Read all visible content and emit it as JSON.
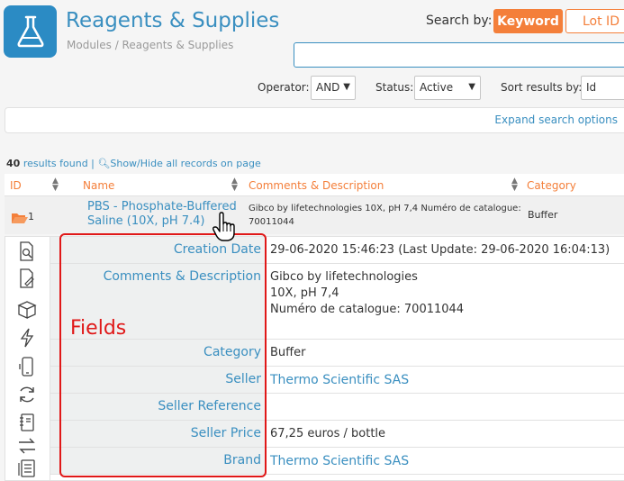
{
  "header": {
    "title": "Reagents & Supplies",
    "breadcrumb": "Modules / Reagents & Supplies",
    "app_icon": "flask-icon"
  },
  "search": {
    "label": "Search by:",
    "keyword_button": "Keyword",
    "lot_button": "Lot ID",
    "input_value": "",
    "operator_label": "Operator:",
    "operator_value": "AND",
    "status_label": "Status:",
    "status_value": "Active",
    "sort_label": "Sort results by:",
    "sort_value": "Id",
    "expand_link": "Expand search options"
  },
  "results": {
    "count": "40",
    "found_text": "results found |",
    "toggle_text": "Show/Hide all records on page"
  },
  "table": {
    "columns": [
      "ID",
      "Name",
      "Comments & Description",
      "Category"
    ],
    "row": {
      "id": "1",
      "name": "PBS - Phosphate-Buffered Saline (10X, pH 7.4)",
      "comments": "Gibco by lifetechnologies 10X, pH 7,4 Numéro de catalogue:  70011044",
      "category": "Buffer"
    }
  },
  "details": {
    "creation_date_label": "Creation Date",
    "creation_date_value": "29-06-2020 15:46:23 (Last Update: 29-06-2020 16:04:13)",
    "comments_label": "Comments & Description",
    "comments_line1": "Gibco by lifetechnologies",
    "comments_line2": "10X, pH 7,4",
    "comments_line3": "Numéro de catalogue:  70011044",
    "category_label": "Category",
    "category_value": "Buffer",
    "seller_label": "Seller",
    "seller_value": "Thermo Scientific SAS",
    "seller_ref_label": "Seller Reference",
    "seller_ref_value": "",
    "seller_price_label": "Seller Price",
    "seller_price_value": "67,25 euros / bottle",
    "brand_label": "Brand",
    "brand_value": "Thermo Scientific SAS"
  },
  "annotation": {
    "fields_label": "Fields"
  },
  "colors": {
    "accent_blue": "#3a8fc0",
    "accent_orange": "#f47f3a",
    "annotation_red": "#e01818"
  }
}
